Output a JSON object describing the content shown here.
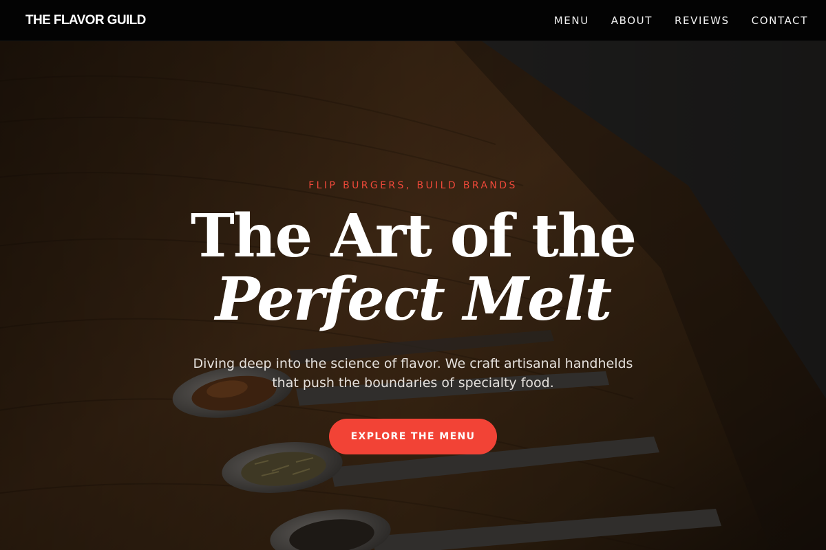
{
  "header": {
    "logo": "THE FLAVOR GUILD",
    "nav": [
      {
        "label": "MENU"
      },
      {
        "label": "ABOUT"
      },
      {
        "label": "REVIEWS"
      },
      {
        "label": "CONTACT"
      }
    ]
  },
  "hero": {
    "eyebrow": "FLIP BURGERS, BUILD BRANDS",
    "headline_line1": "The Art of the",
    "headline_line2": "Perfect Melt",
    "subtext": "Diving deep into the science of flavor. We craft artisanal handhelds that push the boundaries of specialty food.",
    "cta_label": "EXPLORE THE MENU",
    "background_description_icon": "spice-spoons-photo"
  },
  "colors": {
    "accent": "#f24336",
    "eyebrow": "#f0493a",
    "nav_bg": "#030303",
    "text": "#ffffff"
  }
}
